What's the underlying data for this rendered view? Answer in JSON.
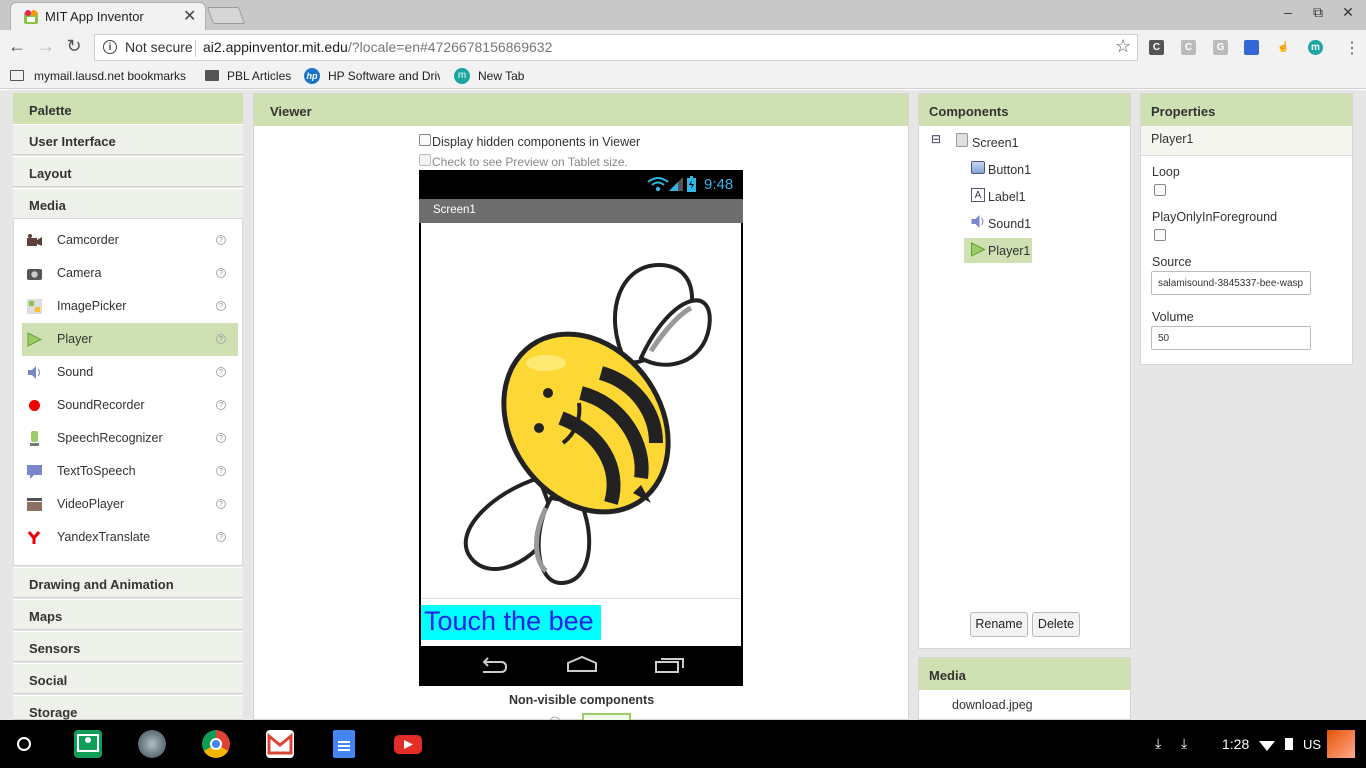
{
  "browser": {
    "tab_title": "MIT App Inventor",
    "tab_close": "✕",
    "window_controls": [
      "–",
      "⧉",
      "✕"
    ],
    "nav": {
      "back": "←",
      "forward": "→",
      "reload": "↻"
    },
    "not_secure": "Not secure",
    "url_host": "ai2.appinventor.mit.edu",
    "url_rest": "/?locale=en#4726678156869632",
    "star": "☆",
    "extensions": [
      "C",
      "C",
      "G",
      "",
      "",
      "m"
    ],
    "menu": "⋮"
  },
  "bookmarks": [
    {
      "label": "mymail.lausd.net bookmarks",
      "icon": "bookmark-icon"
    },
    {
      "label": "PBL Articles",
      "icon": "folder-icon"
    },
    {
      "label": "HP Software and Driv",
      "icon": "hp-icon"
    },
    {
      "label": "New Tab",
      "icon": "m-icon"
    }
  ],
  "palette": {
    "title": "Palette",
    "categories_top": [
      "User Interface",
      "Layout",
      "Media"
    ],
    "media_items": [
      {
        "label": "Camcorder",
        "icon": "camcorder-icon"
      },
      {
        "label": "Camera",
        "icon": "camera-icon"
      },
      {
        "label": "ImagePicker",
        "icon": "imagepicker-icon"
      },
      {
        "label": "Player",
        "icon": "player-icon",
        "selected": true
      },
      {
        "label": "Sound",
        "icon": "sound-icon"
      },
      {
        "label": "SoundRecorder",
        "icon": "soundrecorder-icon"
      },
      {
        "label": "SpeechRecognizer",
        "icon": "speechrecognizer-icon"
      },
      {
        "label": "TextToSpeech",
        "icon": "texttospeech-icon"
      },
      {
        "label": "VideoPlayer",
        "icon": "videoplayer-icon"
      },
      {
        "label": "YandexTranslate",
        "icon": "yandextranslate-icon"
      }
    ],
    "help": "?",
    "categories_bottom": [
      "Drawing and Animation",
      "Maps",
      "Sensors",
      "Social",
      "Storage"
    ]
  },
  "viewer": {
    "title": "Viewer",
    "hidden_checkbox_label": "Display hidden components in Viewer",
    "tablet_checkbox_label": "Check to see Preview on Tablet size.",
    "phone_time": "9:48",
    "screen_title": "Screen1",
    "label_text": "Touch the bee",
    "nonvisible_title": "Non-visible components"
  },
  "components": {
    "title": "Components",
    "collapse": "⊟",
    "tree": [
      {
        "label": "Screen1",
        "icon": "screen-icon"
      },
      {
        "label": "Button1",
        "icon": "button-icon"
      },
      {
        "label": "Label1",
        "icon": "label-icon"
      },
      {
        "label": "Sound1",
        "icon": "sound-icon"
      },
      {
        "label": "Player1",
        "icon": "player-icon",
        "selected": true
      }
    ],
    "rename": "Rename",
    "delete": "Delete"
  },
  "media": {
    "title": "Media",
    "files": [
      "download.jpeg"
    ]
  },
  "properties": {
    "title": "Properties",
    "component": "Player1",
    "loop_label": "Loop",
    "loop_checked": false,
    "foreground_label": "PlayOnlyInForeground",
    "foreground_checked": false,
    "source_label": "Source",
    "source_value": "salamisound-3845337-bee-wasp",
    "volume_label": "Volume",
    "volume_value": "50"
  },
  "taskbar": {
    "time": "1:28",
    "locale": "US",
    "apps": [
      "google-classroom-icon",
      "files-icon",
      "chrome-icon",
      "gmail-icon",
      "docs-icon",
      "youtube-icon"
    ]
  },
  "colors": {
    "panel_header": "#cfe0b2",
    "selected": "#cfe0b2",
    "label_bg": "#00ffff",
    "label_text": "#2222ee"
  }
}
